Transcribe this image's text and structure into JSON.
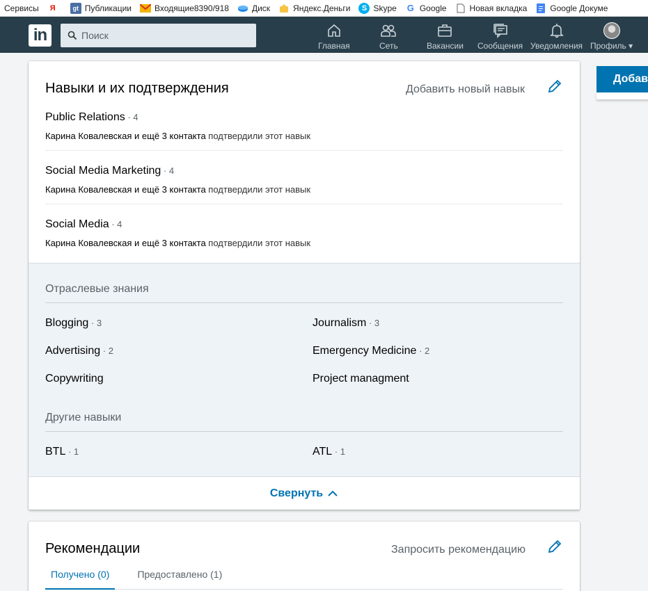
{
  "bookmarks": [
    {
      "label": "Сервисы",
      "icon": "apps-icon"
    },
    {
      "label": "",
      "icon": "yandex-icon",
      "glyph": "Я"
    },
    {
      "label": "Публикации",
      "icon": "gt-icon",
      "glyph": "gt"
    },
    {
      "label": "Входящие8390/918",
      "icon": "gmail-icon"
    },
    {
      "label": "Диск",
      "icon": "disk-icon"
    },
    {
      "label": "Яндекс.Деньги",
      "icon": "money-icon"
    },
    {
      "label": "Skype",
      "icon": "skype-icon",
      "glyph": "S"
    },
    {
      "label": "Google",
      "icon": "google-icon",
      "glyph": "G"
    },
    {
      "label": "Новая вкладка",
      "icon": "page-icon"
    },
    {
      "label": "Google Докуме",
      "icon": "docs-icon"
    }
  ],
  "nav": {
    "search_placeholder": "Поиск",
    "items": [
      {
        "label": "Главная"
      },
      {
        "label": "Сеть"
      },
      {
        "label": "Вакансии"
      },
      {
        "label": "Сообщения"
      },
      {
        "label": "Уведомления"
      },
      {
        "label": "Профиль ▾"
      }
    ]
  },
  "skills": {
    "title": "Навыки и их подтверждения",
    "add_label": "Добавить новый навык",
    "top": [
      {
        "name": "Public Relations",
        "count": " · 4",
        "who": "Карина Ковалевская и ещё 3 контакта",
        "rest": " подтвердили этот навык"
      },
      {
        "name": "Social Media Marketing",
        "count": " · 4",
        "who": "Карина Ковалевская и ещё 3 контакта",
        "rest": " подтвердили этот навык"
      },
      {
        "name": "Social Media",
        "count": " · 4",
        "who": "Карина Ковалевская и ещё 3 контакта",
        "rest": " подтвердили этот навык"
      }
    ],
    "industry_title": "Отраслевые знания",
    "industry": [
      {
        "name": "Blogging",
        "count": " · 3"
      },
      {
        "name": "Journalism",
        "count": " · 3"
      },
      {
        "name": "Advertising",
        "count": " · 2"
      },
      {
        "name": "Emergency Medicine",
        "count": " · 2"
      },
      {
        "name": "Copywriting",
        "count": ""
      },
      {
        "name": "Project managment",
        "count": ""
      }
    ],
    "other_title": "Другие навыки",
    "other": [
      {
        "name": "BTL",
        "count": " · 1"
      },
      {
        "name": "ATL",
        "count": " · 1"
      }
    ],
    "collapse_label": "Свернуть"
  },
  "recommendations": {
    "title": "Рекомендации",
    "request_label": "Запросить рекомендацию",
    "tabs": [
      {
        "label": "Получено (0)",
        "active": true
      },
      {
        "label": "Предоставлено (1)",
        "active": false
      }
    ]
  },
  "side": {
    "button_label": "Добави"
  }
}
